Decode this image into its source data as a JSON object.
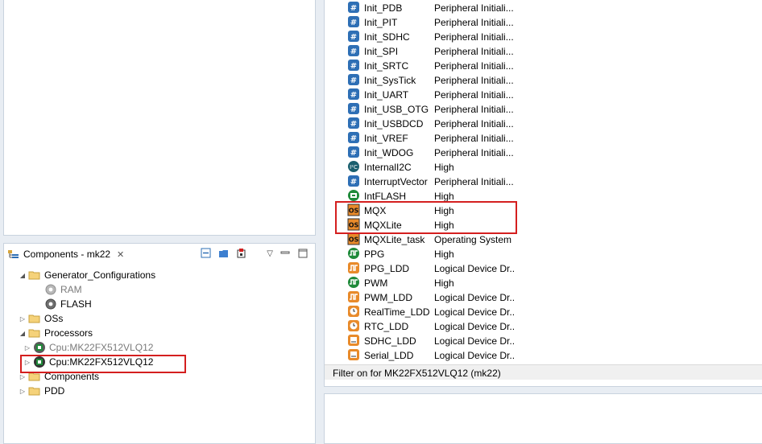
{
  "components_view": {
    "tab_title": "Components - mk22",
    "tree": [
      {
        "label": "Generator_Configurations",
        "level": 0,
        "expanded": true
      },
      {
        "label": "RAM",
        "level": 1,
        "disabled": true
      },
      {
        "label": "FLASH",
        "level": 1
      },
      {
        "label": "OSs",
        "level": 0,
        "expanded": false
      },
      {
        "label": "Processors",
        "level": 0,
        "expanded": true
      },
      {
        "label": "Cpu:MK22FX512VLQ12",
        "level": 1,
        "disabled": true
      },
      {
        "label": "Cpu:MK22FX512VLQ12",
        "level": 1
      },
      {
        "label": "Components",
        "level": 0
      },
      {
        "label": "PDD",
        "level": 0
      }
    ]
  },
  "component_library": {
    "rows": [
      {
        "name": "Init_PDB",
        "category": "Peripheral Initiali...",
        "icon": "init-icon"
      },
      {
        "name": "Init_PIT",
        "category": "Peripheral Initiali...",
        "icon": "init-icon"
      },
      {
        "name": "Init_SDHC",
        "category": "Peripheral Initiali...",
        "icon": "init-icon"
      },
      {
        "name": "Init_SPI",
        "category": "Peripheral Initiali...",
        "icon": "init-icon"
      },
      {
        "name": "Init_SRTC",
        "category": "Peripheral Initiali...",
        "icon": "init-icon"
      },
      {
        "name": "Init_SysTick",
        "category": "Peripheral Initiali...",
        "icon": "init-icon"
      },
      {
        "name": "Init_UART",
        "category": "Peripheral Initiali...",
        "icon": "init-icon"
      },
      {
        "name": "Init_USB_OTG",
        "category": "Peripheral Initiali...",
        "icon": "init-icon"
      },
      {
        "name": "Init_USBDCD",
        "category": "Peripheral Initiali...",
        "icon": "init-icon"
      },
      {
        "name": "Init_VREF",
        "category": "Peripheral Initiali...",
        "icon": "init-icon"
      },
      {
        "name": "Init_WDOG",
        "category": "Peripheral Initiali...",
        "icon": "init-icon"
      },
      {
        "name": "InternalI2C",
        "category": "High",
        "icon": "i2c-icon"
      },
      {
        "name": "InterruptVector",
        "category": "Peripheral Initiali...",
        "icon": "init-icon"
      },
      {
        "name": "IntFLASH",
        "category": "High",
        "icon": "flash-icon"
      },
      {
        "name": "MQX",
        "category": "High",
        "icon": "os-icon"
      },
      {
        "name": "MQXLite",
        "category": "High",
        "icon": "os-icon"
      },
      {
        "name": "MQXLite_task",
        "category": "Operating System",
        "icon": "os-icon"
      },
      {
        "name": "PPG",
        "category": "High",
        "icon": "pulse-green-icon"
      },
      {
        "name": "PPG_LDD",
        "category": "Logical Device Dr...",
        "icon": "pulse-orange-icon"
      },
      {
        "name": "PWM",
        "category": "High",
        "icon": "pulse-green-icon"
      },
      {
        "name": "PWM_LDD",
        "category": "Logical Device Dr...",
        "icon": "pulse-orange-icon"
      },
      {
        "name": "RealTime_LDD",
        "category": "Logical Device Dr...",
        "icon": "clock-orange-icon"
      },
      {
        "name": "RTC_LDD",
        "category": "Logical Device Dr...",
        "icon": "clock-orange-icon"
      },
      {
        "name": "SDHC_LDD",
        "category": "Logical Device Dr...",
        "icon": "card-orange-icon"
      },
      {
        "name": "Serial_LDD",
        "category": "Logical Device Dr...",
        "icon": "card-orange-icon"
      }
    ],
    "status": "Filter on for MK22FX512VLQ12 (mk22)"
  },
  "colors": {
    "init_blue": "#2e6fb5",
    "os_orange": "#e88a2a",
    "green": "#1f8a3a",
    "highlight": "#d41f1f"
  }
}
